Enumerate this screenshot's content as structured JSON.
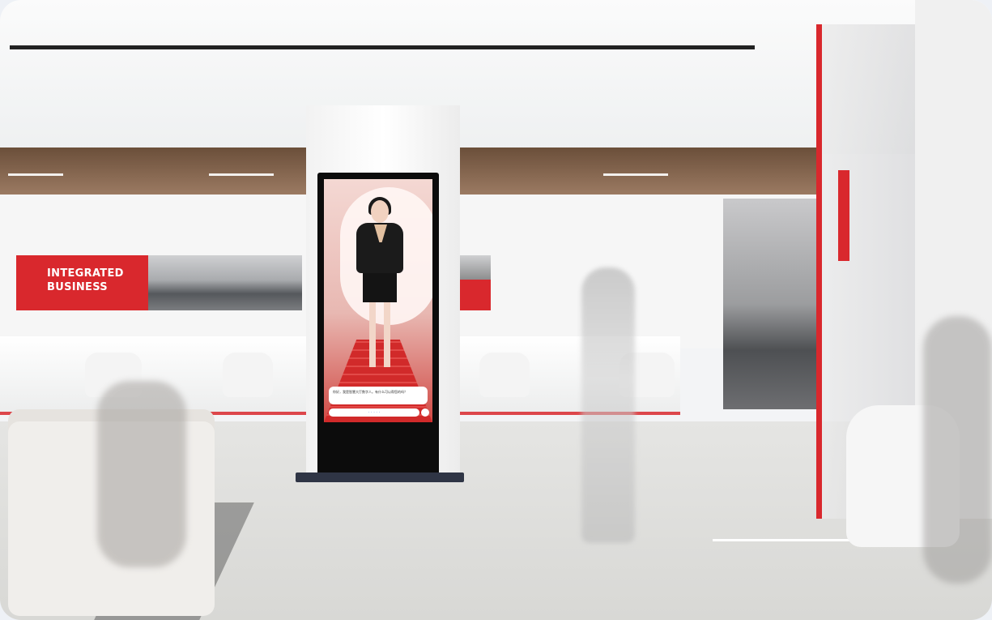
{
  "scene": {
    "signage": {
      "line1": "INTEGRATED",
      "line2": "BUSINESS"
    },
    "kiosk": {
      "subtitle": "你好，我是智慧大厅数字人。有什么可以帮您的吗？",
      "controls": "· · · · ·"
    },
    "colors": {
      "brand_red": "#d9282d",
      "kiosk_frame": "#0c0c0c",
      "kiosk_base": "#2f3545"
    }
  }
}
